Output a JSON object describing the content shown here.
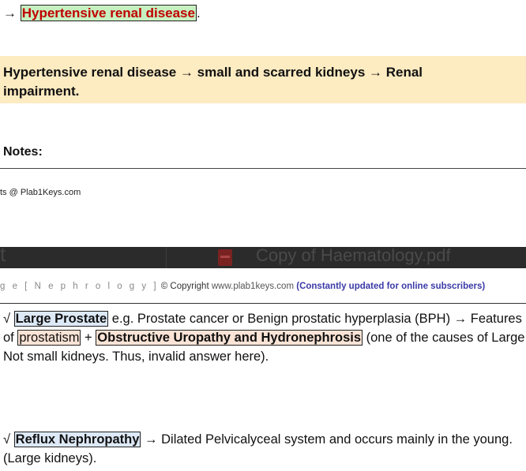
{
  "line1": {
    "arrow": "→",
    "highlight": "Hypertensive renal disease",
    "period": "."
  },
  "summary": {
    "text": "Hypertensive renal disease → small and scarred kidneys → Renal impairment."
  },
  "notes": {
    "label": "Notes:"
  },
  "footer_copyright": "ts @ Plab1Keys.com",
  "pdf_bar": {
    "left_stub": "t",
    "filename": "Copy of Haematology.pdf"
  },
  "page_header": {
    "section": "g e  [ N e p h r o l o g y ]",
    "copyright": "© Copyright",
    "site": "www.plab1keys.com",
    "note": "(Constantly updated for online subscribers)"
  },
  "para1": {
    "check": "√",
    "term": "Large Prostate",
    "t1": " e.g. Prostate cancer or Benign prostatic hyperplasia (BPH) → Features of ",
    "hl1": "prostatism",
    "t2": " + ",
    "hl2": "Obstructive Uropathy and Hydronephrosis",
    "t3": " (one of the causes of Large Not small kidneys. Thus, invalid answer here)."
  },
  "para2": {
    "check": "√",
    "term": "Reflux Nephropathy",
    "t1": " → Dilated Pelvicalyceal system and occurs mainly in the young. (Large kidneys)."
  }
}
